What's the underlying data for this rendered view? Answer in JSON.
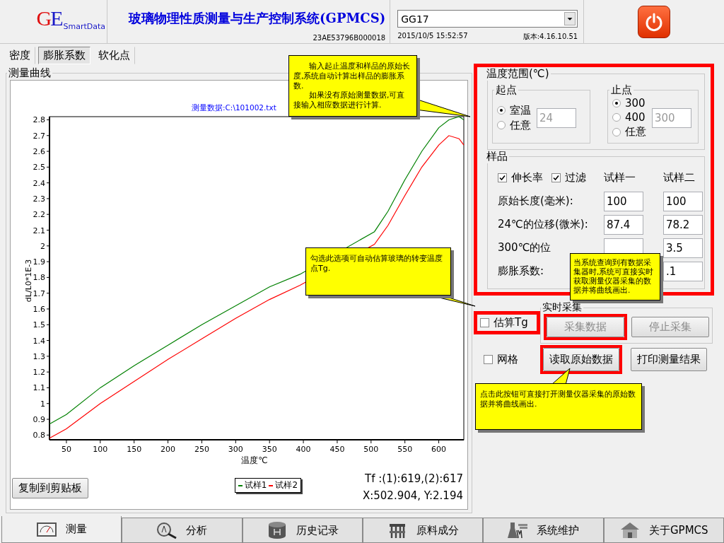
{
  "header": {
    "logo": [
      {
        "text": "G",
        "color": "#e01010"
      },
      {
        "text": "E",
        "color": "#1818c8"
      }
    ],
    "logo_text": "SmartData",
    "title": "玻璃物理性质测量与生产控制系统(GPMCS)",
    "serial": "23AE53796B000018",
    "device": "GG17",
    "datetime": "2015/10/5 15:52:57",
    "version": "版本:4.16.10.51"
  },
  "subtabs": [
    {
      "label": "密度",
      "selected": false
    },
    {
      "label": "膨胀系数",
      "selected": true
    },
    {
      "label": "软化点",
      "selected": false
    }
  ],
  "chart_panel": {
    "title": "测量曲线",
    "chart_data": {
      "type": "line",
      "title": "测量数据:C:\\101002.txt",
      "xlabel": "温度℃",
      "ylabel": "dL/L0*1E-3",
      "x": [
        25,
        50,
        100,
        150,
        200,
        250,
        300,
        350,
        395,
        505,
        525,
        550,
        575,
        600,
        615,
        630,
        637
      ],
      "series": [
        {
          "name": "试样1",
          "color": "#008000",
          "values": [
            0.87,
            0.93,
            1.1,
            1.24,
            1.37,
            1.5,
            1.62,
            1.74,
            1.82,
            2.09,
            2.22,
            2.42,
            2.6,
            2.75,
            2.8,
            2.82,
            2.8
          ]
        },
        {
          "name": "试样2",
          "color": "#ff0000",
          "values": [
            0.78,
            0.84,
            1.0,
            1.14,
            1.28,
            1.41,
            1.54,
            1.66,
            1.75,
            2.01,
            2.13,
            2.32,
            2.5,
            2.64,
            2.7,
            2.68,
            2.64
          ]
        }
      ],
      "xlim": [
        25,
        637
      ],
      "ylim": [
        0.77,
        2.82
      ],
      "xticks": [
        50,
        100,
        150,
        200,
        250,
        300,
        350,
        400,
        450,
        500,
        550,
        600
      ],
      "yticks": [
        0.8,
        0.9,
        1,
        1.1,
        1.2,
        1.3,
        1.4,
        1.5,
        1.6,
        1.7,
        1.8,
        1.9,
        2,
        2.1,
        2.2,
        2.3,
        2.4,
        2.5,
        2.6,
        2.7,
        2.8
      ]
    },
    "copy_button": "复制到剪贴板",
    "readout": [
      "Tf :(1):619,(2):617",
      "X:502.904, Y:2.194"
    ]
  },
  "temperature_range": {
    "title": "温度范围(℃)",
    "start": {
      "title": "起点",
      "options": [
        {
          "label": "室温",
          "selected": true
        },
        {
          "label": "任意",
          "selected": false
        }
      ],
      "value": "24",
      "disabled": true
    },
    "end": {
      "title": "止点",
      "options": [
        {
          "label": "300",
          "selected": true
        },
        {
          "label": "400",
          "selected": false
        },
        {
          "label": "任意",
          "selected": false
        }
      ],
      "value": "300",
      "disabled": true
    }
  },
  "sample": {
    "title": "样品",
    "checkboxes": [
      {
        "label": "伸长率",
        "checked": true
      },
      {
        "label": "过滤",
        "checked": true
      }
    ],
    "columns": [
      "试样一",
      "试样二"
    ],
    "rows": [
      {
        "label": "原始长度(毫米):",
        "sample_1": "100",
        "sample_2": "100"
      },
      {
        "label": "24℃的位移(微米):",
        "sample_1": "87.4",
        "sample_2": "78.2"
      },
      {
        "label": "300℃的位",
        "sample_2": "3.5"
      },
      {
        "label": "膨胀系数:",
        "sample_2": ".1"
      }
    ]
  },
  "estimate_tg": {
    "label": "估算Tg",
    "checked": false
  },
  "realtime": {
    "title": "实时采集",
    "buttons": [
      {
        "label": "采集数据",
        "disabled": true
      },
      {
        "label": "停止采集",
        "disabled": true
      }
    ]
  },
  "grid": {
    "label": "网格",
    "checked": false
  },
  "actions": [
    "读取原始数据",
    "打印测量结果"
  ],
  "callouts": [
    {
      "paragraphs": [
        "输入起止温度和样品的原始长度,系统自动计算出样品的膨胀系数.",
        "如果没有原始测量数据,可直接输入相应数据进行计算."
      ]
    },
    {
      "paragraphs": [
        "勾选此选项可自动估算玻璃的转变温度点Tg."
      ]
    },
    {
      "paragraphs": [
        "当系统查询到有数据采集器时,系统可直接实时获取测量仪器采集的数据并将曲线画出."
      ]
    },
    {
      "paragraphs": [
        "点击此按钮可直接打开测量仪器采集的原始数据并将曲线画出."
      ]
    }
  ],
  "bottom_tabs": [
    {
      "label": "测量",
      "selected": true
    },
    {
      "label": "分析",
      "selected": false
    },
    {
      "label": "历史记录",
      "selected": false
    },
    {
      "label": "原料成分",
      "selected": false
    },
    {
      "label": "系统维护",
      "selected": false
    },
    {
      "label": "关于GPMCS",
      "selected": false
    }
  ]
}
